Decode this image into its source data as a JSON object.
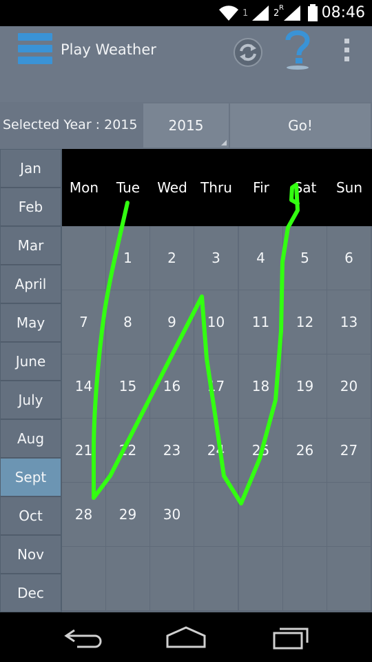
{
  "status_bar": {
    "time": "08:46",
    "sim1_label": "1",
    "sim2_label": "2",
    "sim2_roaming": "R",
    "icons": [
      "wifi-icon",
      "signal-icon",
      "signal-icon",
      "battery-icon"
    ]
  },
  "app_bar": {
    "title": "Play Weather",
    "icons": [
      "menu-icon",
      "refresh-icon",
      "help-icon",
      "overflow-icon"
    ]
  },
  "year_row": {
    "label": "Selected Year : 2015",
    "year_value": "2015",
    "go_label": "Go!"
  },
  "months": [
    "Jan",
    "Feb",
    "Mar",
    "April",
    "May",
    "June",
    "July",
    "Aug",
    "Sept",
    "Oct",
    "Nov",
    "Dec"
  ],
  "selected_month": "Sept",
  "weekdays": [
    "Mon",
    "Tue",
    "Wed",
    "Thru",
    "Fir",
    "Sat",
    "Sun"
  ],
  "calendar_weeks": [
    [
      "",
      "1",
      "2",
      "3",
      "4",
      "5",
      "6"
    ],
    [
      "7",
      "8",
      "9",
      "10",
      "11",
      "12",
      "13"
    ],
    [
      "14",
      "15",
      "16",
      "17",
      "18",
      "19",
      "20"
    ],
    [
      "21",
      "22",
      "23",
      "24",
      "25",
      "26",
      "27"
    ],
    [
      "28",
      "29",
      "30",
      "",
      "",
      "",
      ""
    ],
    [
      "",
      "",
      "",
      "",
      "",
      "",
      ""
    ]
  ],
  "colors": {
    "accent_selected": "#6c95b3",
    "menu_icon": "#3a93d6",
    "scribble": "#33ff11"
  },
  "nav_bar": {
    "icons": [
      "back-icon",
      "home-icon",
      "recent-apps-icon"
    ]
  }
}
